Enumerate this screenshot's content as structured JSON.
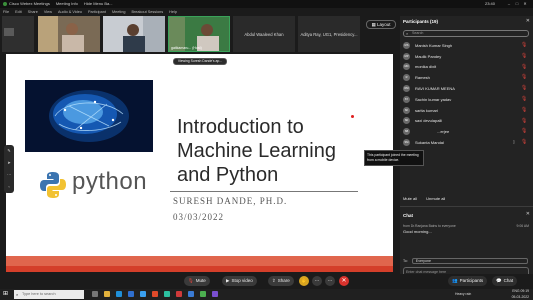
{
  "titlebar": {
    "app_title": "Cisco Webex Meetings",
    "meeting_info": "Meeting Info",
    "hide_menu": "Hide Menu Ba...",
    "clock": "23:40",
    "controls": [
      "–",
      "□",
      "✕"
    ]
  },
  "menubar": [
    "File",
    "Edit",
    "Share",
    "View",
    "Audio & Video",
    "Participant",
    "Meeting",
    "Breakout Sessions",
    "Help"
  ],
  "video_strip": {
    "thumbs": [
      {
        "caption": ""
      },
      {
        "caption": ""
      },
      {
        "caption": "gatikamaru... (Host)"
      }
    ],
    "name_tiles": [
      "Abdul Waaleed Khan",
      "Aditya Ray, UG1, Presidency..."
    ],
    "layout_label": "Layout"
  },
  "stage": {
    "viewing_label": "Viewing Suresh Dande's ap...",
    "slide": {
      "python_word": "python",
      "title_lines": [
        "Introduction to",
        "Machine Learning",
        "and Python"
      ],
      "author": "SURESH DANDE, PH.D.",
      "date": "03/03/2022"
    }
  },
  "tooltip": "This participant joined the meeting from a mobile device.",
  "participants": {
    "header": "Participants (19)",
    "search_placeholder": "Search",
    "list": [
      {
        "initials": "MS",
        "name": "Manish Kumar Singh"
      },
      {
        "initials": "MP",
        "name": "Maulik Pandey"
      },
      {
        "initials": "MD",
        "name": "monika dixit"
      },
      {
        "initials": "R",
        "name": "Ramesh"
      },
      {
        "initials": "RM",
        "name": "RAVI KUMAR MEENA"
      },
      {
        "initials": "SY",
        "name": "Sachin kumar yadav"
      },
      {
        "initials": "SK",
        "name": "sarita kumari"
      },
      {
        "initials": "SD",
        "name": "saxi devulapalli"
      },
      {
        "initials": "SB",
        "name": "...erjee"
      },
      {
        "initials": "SM",
        "name": "Sukanta Mandal"
      }
    ],
    "mute_all": "Mute all",
    "unmute_all": "Unmute all"
  },
  "chat": {
    "header": "Chat",
    "from": "from Dr.Ranjana Bains to everyone",
    "time": "9:06 AM",
    "message": "Good morning...",
    "to_label": "To:",
    "to_value": "Everyone",
    "input_placeholder": "Enter chat message here"
  },
  "controls": {
    "mute": "Mute",
    "stop_video": "Stop video",
    "share": "Share",
    "participants": "Participants",
    "chat": "Chat"
  },
  "taskbar": {
    "search_placeholder": "Type here to search",
    "weather": "Heavy rain",
    "tray_time": "09:19",
    "tray_date": "05-03-2022",
    "lang": "ENG"
  },
  "colors": {
    "accent_red": "#d8322c",
    "slide_bar": "#e0664d",
    "mic_muted": "#e0443c"
  }
}
